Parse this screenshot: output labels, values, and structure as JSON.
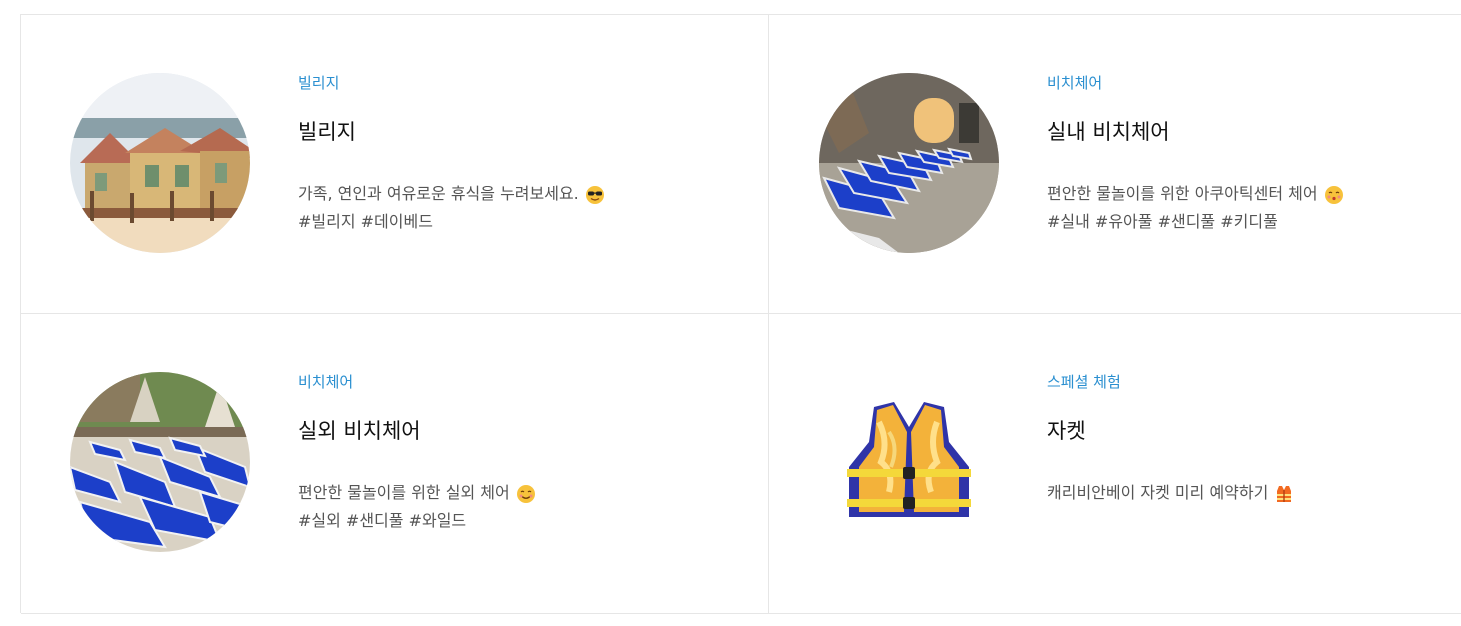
{
  "cards": [
    {
      "category": "빌리지",
      "title": "빌리지",
      "description": "가족, 연인과 여유로운 휴식을 누려보세요.",
      "emoji_icon": "sunglasses-face-icon",
      "tags": "#빌리지 #데이베드",
      "image": "village-cabins-image"
    },
    {
      "category": "비치체어",
      "title": "실내 비치체어",
      "description": "편안한 물놀이를 위한 아쿠아틱센터 체어",
      "emoji_icon": "kissing-face-icon",
      "tags": "#실내 #유아풀 #샌디풀 #키디풀",
      "image": "indoor-beach-chairs-image"
    },
    {
      "category": "비치체어",
      "title": "실외 비치체어",
      "description": "편안한 물놀이를 위한 실외 체어",
      "emoji_icon": "smiling-face-icon",
      "tags": "#실외 #샌디풀 #와일드",
      "image": "outdoor-beach-chairs-image"
    },
    {
      "category": "스페셜 체험",
      "title": "자켓",
      "description": "캐리비안베이 자켓 미리 예약하기",
      "emoji_icon": "safety-vest-icon",
      "tags": "",
      "image": "life-jacket-image"
    }
  ],
  "colors": {
    "category": "#2a8fd0",
    "title": "#111111",
    "text": "#555555",
    "border": "#e6e6e6"
  }
}
